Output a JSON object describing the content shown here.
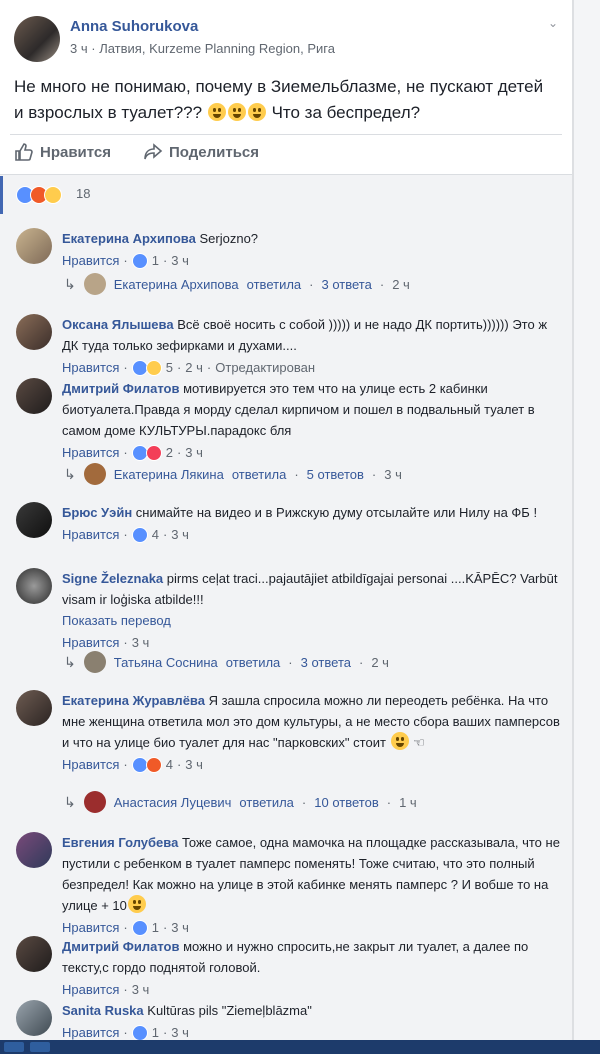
{
  "post": {
    "author": "Anna Suhorukova",
    "time": "3 ч",
    "location": "Латвия, Kurzeme Planning Region, Рига",
    "text_before": "Не много не понимаю, почему в Зиемельблазме, не пускают детей и взрослых в туалет???",
    "text_after": "Что за беспредел?",
    "like_label": "Нравится",
    "share_label": "Поделиться",
    "reactions_count": "18"
  },
  "comments": [
    {
      "name": "Екатерина Архипова",
      "text": "Serjozno?",
      "like": "Нравится",
      "count": "1",
      "time": "3 ч",
      "reply": {
        "name": "Екатерина Архипова",
        "verb": "ответила",
        "count": "3 ответа",
        "time": "2 ч"
      }
    },
    {
      "name": "Оксана Ялышева",
      "text": "Всё своё носить с собой ))))) и не надо ДК портить)))))) Это ж ДК туда только зефирками и духами....",
      "like": "Нравится",
      "count": "5",
      "time": "2 ч",
      "extra": "Отредактирован"
    },
    {
      "name": "Дмитрий Филатов",
      "text": "мотивируется это тем что на улице есть 2 кабинки биотуалета.Правда я морду сделал кирпичом и пошел в подвальный туалет в самом доме КУЛЬТУРЫ.парадокс бля",
      "like": "Нравится",
      "count": "2",
      "time": "3 ч",
      "reply": {
        "name": "Екатерина Лякина",
        "verb": "ответила",
        "count": "5 ответов",
        "time": "3 ч"
      }
    },
    {
      "name": "Брюс Уэйн",
      "text": "снимайте на видео и в Рижскую думу отсылайте или Нилу на ФБ !",
      "like": "Нравится",
      "count": "4",
      "time": "3 ч"
    },
    {
      "name": "Signe Železnaka",
      "text": "pirms ceļat traci...pajautājiet atbildīgajai personai ....KĀPĒC? Varbūt visam ir loģiska atbilde!!!",
      "translate": "Показать перевод",
      "like": "Нравится",
      "time": "3 ч",
      "reply": {
        "name": "Татьяна Соснина",
        "verb": "ответила",
        "count": "3 ответа",
        "time": "2 ч"
      }
    },
    {
      "name": "Екатерина Журавлёва",
      "text": "Я зашла спросила можно ли переодеть ребёнка. На что мне женщина ответила мол это дом культуры, а не место сбора ваших памперсов и что на улице био туалет для нас \"парковских\" стоит",
      "like": "Нравится",
      "count": "4",
      "time": "3 ч",
      "reply": {
        "name": "Анастасия Луцевич",
        "verb": "ответила",
        "count": "10 ответов",
        "time": "1 ч"
      }
    },
    {
      "name": "Евгения Голубева",
      "text": "Тоже самое, одна мамочка на площадке рассказывала, что не пустили с ребенком в туалет памперс поменять! Тоже считаю, что это полный безпредел! Как можно на улице в этой кабинке менять памперс ? И вобше то на улице + 10",
      "like": "Нравится",
      "count": "1",
      "time": "3 ч"
    },
    {
      "name": "Дмитрий Филатов",
      "text": "можно и нужно спросить,не закрыт ли туалет, а далее по тексту,с гордо поднятой головой.",
      "like": "Нравится",
      "time": "3 ч"
    },
    {
      "name": "Sanita Ruska",
      "text": "Kultūras pils \"Ziemeļblāzma\"",
      "like": "Нравится",
      "count": "1",
      "time": "3 ч"
    }
  ],
  "colors": {
    "link": "#365899",
    "meta": "#606770",
    "like_blue": "#5890ff"
  }
}
